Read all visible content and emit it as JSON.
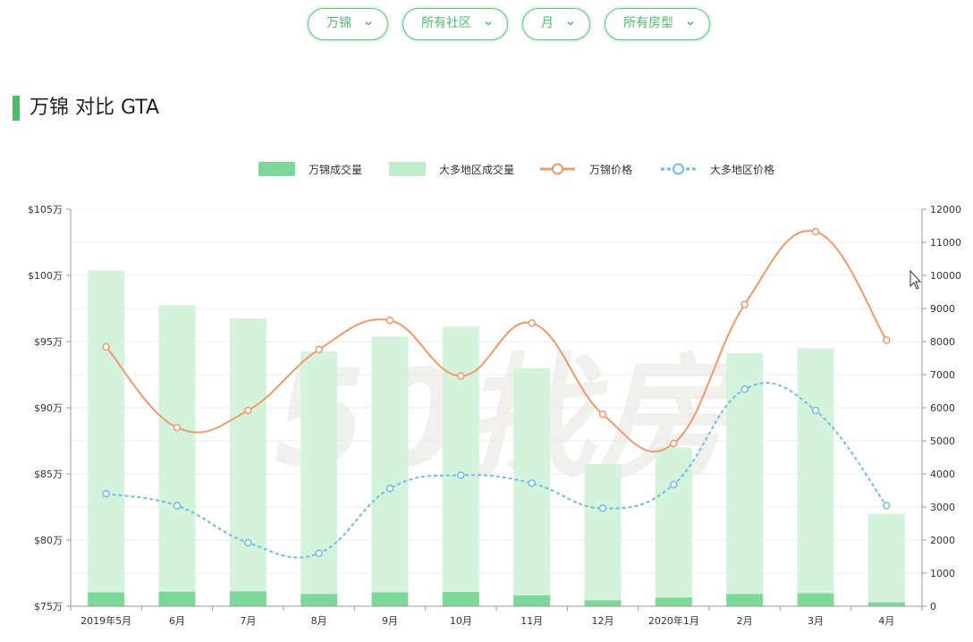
{
  "filters": [
    {
      "label": "万锦"
    },
    {
      "label": "所有社区"
    },
    {
      "label": "月"
    },
    {
      "label": "所有房型"
    }
  ],
  "section": {
    "title": "万锦 对比 GTA"
  },
  "colors": {
    "accent": "#4cbc6c",
    "bar_local": "#7ed89a",
    "bar_region": "#d2f2da",
    "line_local": "#f0996a",
    "line_region": "#6fbbe8"
  },
  "watermark_text": "50找房",
  "chart_data": {
    "type": "bar",
    "categories": [
      "2019年5月",
      "6月",
      "7月",
      "8月",
      "9月",
      "10月",
      "11月",
      "12月",
      "2020年1月",
      "2月",
      "3月",
      "4月"
    ],
    "left_axis": {
      "min": 75,
      "max": 105,
      "ticks": [
        "$75万",
        "$80万",
        "$85万",
        "$90万",
        "$95万",
        "$100万",
        "$105万"
      ]
    },
    "right_axis": {
      "min": 0,
      "max": 12000,
      "ticks": [
        "0",
        "1000",
        "2000",
        "3000",
        "4000",
        "5000",
        "6000",
        "7000",
        "8000",
        "9000",
        "10000",
        "11000",
        "12000"
      ]
    },
    "grid": true,
    "legend_position": "top",
    "series": [
      {
        "name": "万锦成交量",
        "kind": "bar",
        "axis": "right",
        "values": [
          420,
          440,
          450,
          370,
          420,
          430,
          330,
          180,
          260,
          370,
          390,
          120
        ]
      },
      {
        "name": "大多地区成交量",
        "kind": "bar",
        "axis": "right",
        "values": [
          10150,
          9100,
          8700,
          7700,
          8150,
          8450,
          7200,
          4300,
          4800,
          7650,
          7800,
          2800
        ]
      },
      {
        "name": "万锦价格",
        "kind": "line",
        "axis": "left",
        "values": [
          94.6,
          88.5,
          89.8,
          94.4,
          96.6,
          92.4,
          96.4,
          89.5,
          87.3,
          97.8,
          103.3,
          95.1
        ]
      },
      {
        "name": "大多地区价格",
        "kind": "line",
        "axis": "left",
        "values": [
          83.5,
          82.6,
          79.8,
          79.0,
          83.9,
          84.9,
          84.3,
          82.4,
          84.2,
          91.4,
          89.8,
          82.6
        ]
      }
    ]
  }
}
